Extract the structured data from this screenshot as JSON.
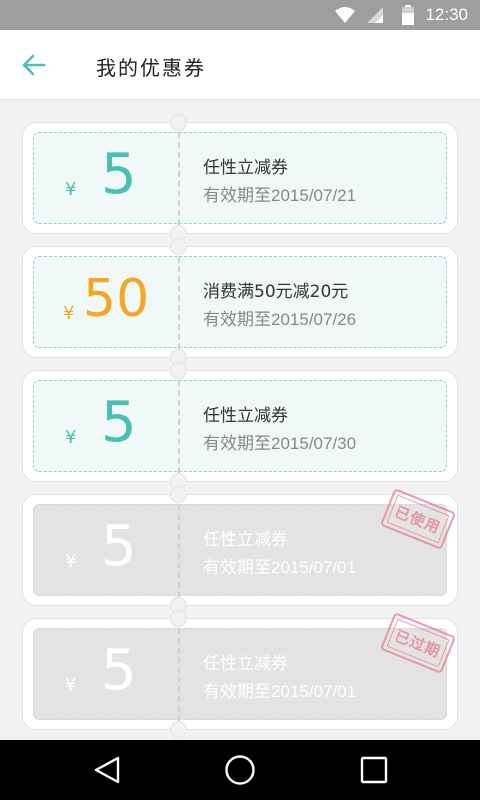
{
  "status_bar": {
    "time": "12:30",
    "icons": [
      "wifi-icon",
      "signal-icon",
      "battery-icon"
    ]
  },
  "app_bar": {
    "title": "我的优惠券",
    "back_icon": "arrow-left-icon"
  },
  "colors": {
    "accent": "#48c1b3",
    "orange": "#f5a623",
    "stamp": "#e58a9a",
    "gray": "#e3e3e3"
  },
  "coupons": [
    {
      "currency": "¥",
      "amount": "5",
      "title": "任性立减券",
      "validity": "有效期至2015/07/21",
      "state": "active",
      "color": "teal"
    },
    {
      "currency": "¥",
      "amount": "50",
      "title": "消费满50元减20元",
      "validity": "有效期至2015/07/26",
      "state": "active",
      "color": "orange"
    },
    {
      "currency": "¥",
      "amount": "5",
      "title": "任性立减券",
      "validity": "有效期至2015/07/30",
      "state": "active",
      "color": "teal"
    },
    {
      "currency": "¥",
      "amount": "5",
      "title": "任性立减券",
      "validity": "有效期至2015/07/01",
      "state": "used",
      "stamp": "已使用",
      "color": "gray"
    },
    {
      "currency": "¥",
      "amount": "5",
      "title": "任性立减券",
      "validity": "有效期至2015/07/01",
      "state": "expired",
      "stamp": "已过期",
      "color": "gray"
    }
  ],
  "nav_bar": {
    "icons": [
      "back-triangle-icon",
      "home-circle-icon",
      "recents-square-icon"
    ]
  }
}
